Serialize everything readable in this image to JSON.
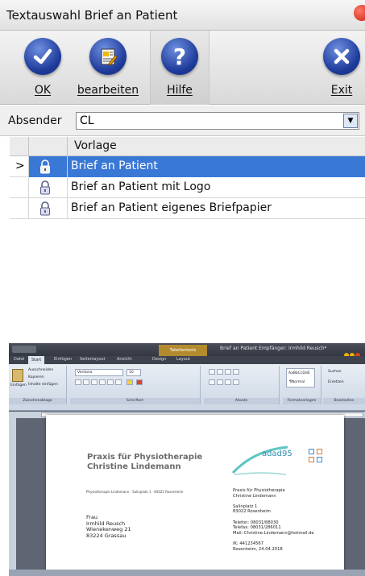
{
  "dialog": {
    "title": "Textauswahl Brief an Patient",
    "toolbar": {
      "ok_label": "OK",
      "edit_label": "bearbeiten",
      "help_label": "Hilfe",
      "exit_label": "Exit"
    },
    "sender": {
      "label": "Absender",
      "value": "CL"
    },
    "grid": {
      "column_header": "Vorlage",
      "rows": [
        {
          "name": "Brief an Patient",
          "selected": true
        },
        {
          "name": "Brief an Patient mit Logo",
          "selected": false
        },
        {
          "name": "Brief an Patient eigenes Briefpapier",
          "selected": false
        }
      ]
    },
    "colors": {
      "selection": "#3a78d6",
      "icon_blue": "#1e3a9a",
      "close_red": "#c81d0b"
    }
  },
  "word": {
    "title": "Brief an Patient Empfänger: Irmhild Reusch*",
    "context_tab": "Tabellentools",
    "tabs": [
      "Datei",
      "Start",
      "Einfügen",
      "Seitenlayout",
      "Ansicht",
      "Design",
      "Layout"
    ],
    "ribbon": {
      "paste": "Einfügen",
      "cut": "Ausschneiden",
      "copy": "Kopieren",
      "paste_content": "Inhalte einfügen",
      "clipboard_group": "Zwischenablage",
      "font_name": "Verdana",
      "font_size": "10",
      "font_group": "Schriftart",
      "paragraph_group": "Absatz",
      "style_preview": "AaBbCcDdE",
      "style_name": "¶Normal",
      "styles_group": "Formatvorlagen",
      "find": "Suchen",
      "replace": "Ersetzen",
      "edit_group": "Bearbeiten"
    },
    "letter": {
      "practice_line1": "Praxis für Physiotherapie",
      "practice_line2": "Christine Lindemann",
      "logo_text": "adad95",
      "sender_line": "Physiotherapie Lindemann · Salinplatz 1 · 83022 Rosenheim",
      "recipient": [
        "Frau",
        "Irmhild Reusch",
        "Wienekenweg 21",
        "83224 Grassau"
      ],
      "contact": [
        "Praxis für Physiotherapie",
        "Christine Lindemann",
        "",
        "Salinplatz 1",
        "83022 Rosenheim",
        "",
        "Telefon: 08031/88030",
        "Telefax: 08031/286011",
        "Mail: Christine.Lindemann@hotmail.de",
        "",
        "IK: 441234567",
        "Rosenheim, 24.04.2018"
      ]
    }
  }
}
